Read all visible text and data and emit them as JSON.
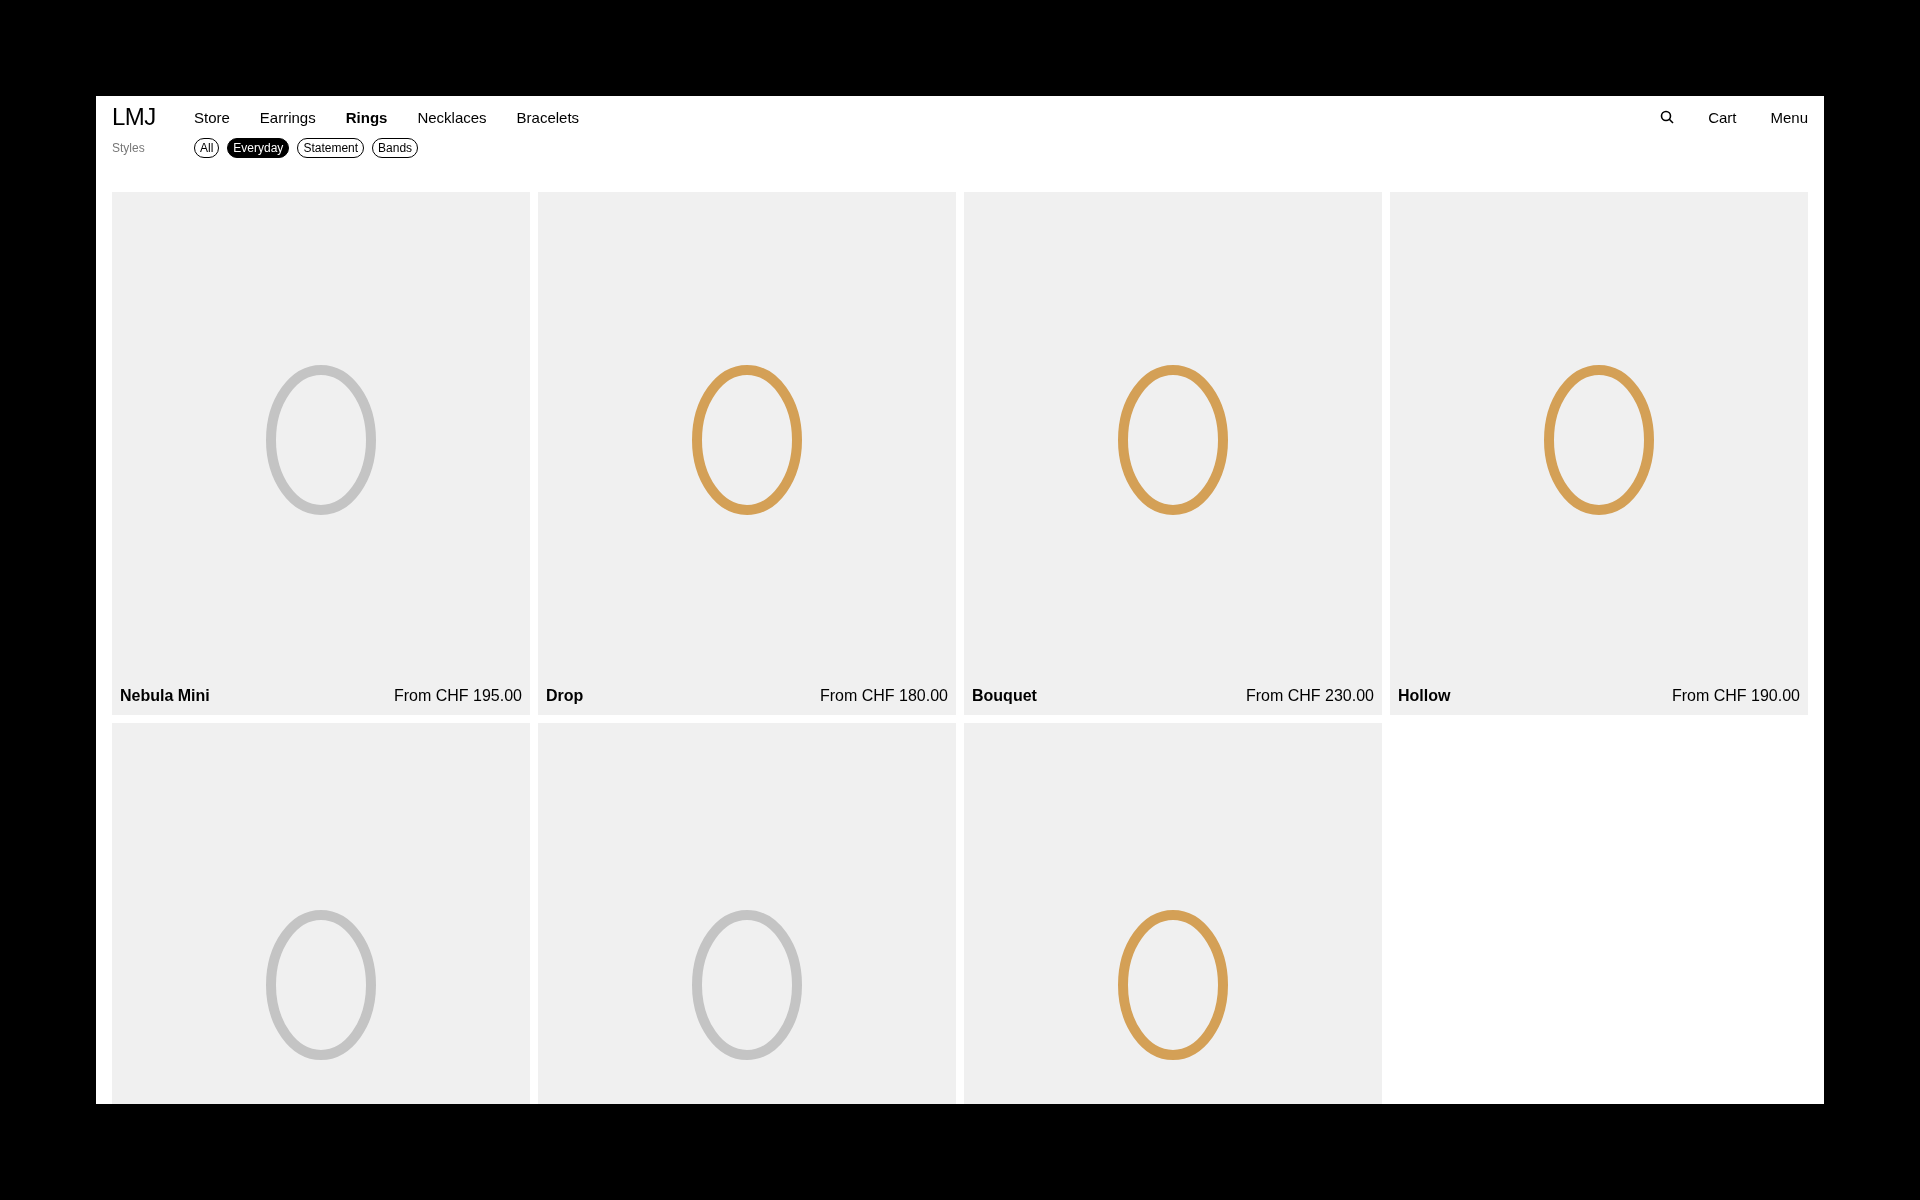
{
  "header": {
    "logo": "LMJ",
    "nav": [
      {
        "label": "Store",
        "selected": false
      },
      {
        "label": "Earrings",
        "selected": false
      },
      {
        "label": "Rings",
        "selected": true
      },
      {
        "label": "Necklaces",
        "selected": false
      },
      {
        "label": "Bracelets",
        "selected": false
      }
    ],
    "actions": [
      "Cart",
      "Menu"
    ]
  },
  "filters": {
    "label": "Styles",
    "options": [
      {
        "label": "All",
        "selected": false
      },
      {
        "label": "Everyday",
        "selected": true
      },
      {
        "label": "Statement",
        "selected": false
      },
      {
        "label": "Bands",
        "selected": false
      }
    ]
  },
  "products": [
    {
      "name": "Nebula Mini",
      "price": "From CHF 195.00",
      "kind": "silver"
    },
    {
      "name": "Drop",
      "price": "From CHF 180.00",
      "kind": "gold"
    },
    {
      "name": "Bouquet",
      "price": "From CHF 230.00",
      "kind": "gold"
    },
    {
      "name": "Hollow",
      "price": "From CHF 190.00",
      "kind": "gold"
    },
    {
      "kind": "silver"
    },
    {
      "kind": "silver"
    },
    {
      "kind": "gold"
    }
  ]
}
